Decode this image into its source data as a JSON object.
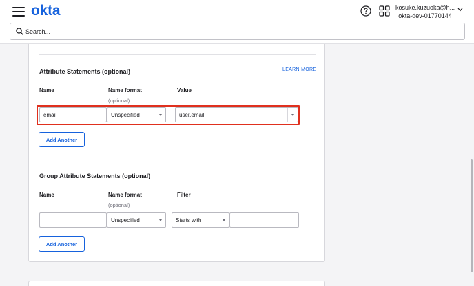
{
  "header": {
    "logo": "okta",
    "user_email": "kosuke.kuzuoka@h...",
    "user_org": "okta-dev-01770144",
    "icons": [
      "menu-icon",
      "help-icon",
      "apps-grid-icon",
      "chevron-down-icon"
    ]
  },
  "search": {
    "placeholder": "Search..."
  },
  "attribute_statements": {
    "title": "Attribute Statements (optional)",
    "learn_more": "LEARN MORE",
    "col_name": "Name",
    "col_name_format": "Name format",
    "col_name_format_hint": "(optional)",
    "col_value": "Value",
    "row": {
      "name": "email",
      "name_format": "Unspecified",
      "value": "user.email"
    },
    "add_another": "Add Another"
  },
  "group_attribute_statements": {
    "title": "Group Attribute Statements (optional)",
    "col_name": "Name",
    "col_name_format": "Name format",
    "col_name_format_hint": "(optional)",
    "col_filter": "Filter",
    "row": {
      "name": "",
      "name_format": "Unspecified",
      "filter_type": "Starts with",
      "filter_value": ""
    },
    "add_another": "Add Another"
  },
  "colors": {
    "brand": "#1662dd",
    "highlight": "#e0301e"
  }
}
